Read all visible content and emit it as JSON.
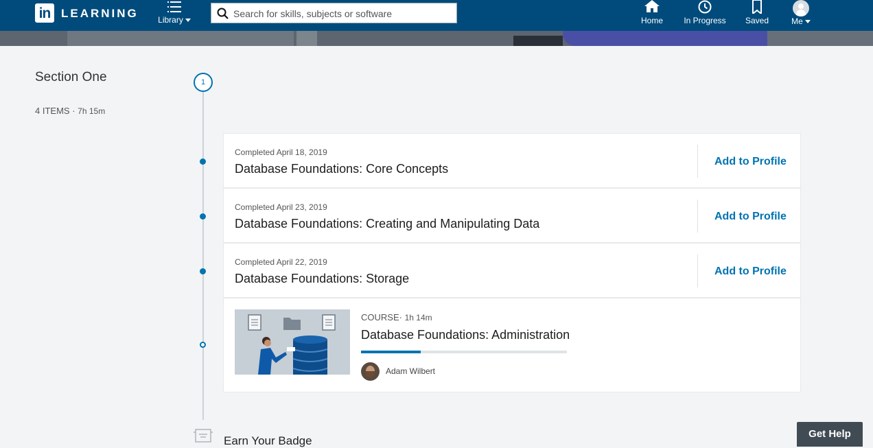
{
  "header": {
    "logo_mark": "in",
    "logo_word": "LEARNING",
    "library_label": "Library",
    "search_placeholder": "Search for skills, subjects or software",
    "nav": {
      "home": "Home",
      "in_progress": "In Progress",
      "saved": "Saved",
      "me": "Me"
    },
    "brand_color": "#004b7c"
  },
  "section": {
    "number": "1",
    "title": "Section One",
    "items_count": "4 ITEMS",
    "separator": "·",
    "duration": "7h 15m"
  },
  "courses": [
    {
      "completed": "Completed April 18, 2019",
      "title": "Database Foundations: Core Concepts",
      "action": "Add to Profile"
    },
    {
      "completed": "Completed April 23, 2019",
      "title": "Database Foundations: Creating and Manipulating Data",
      "action": "Add to Profile"
    },
    {
      "completed": "Completed April 22, 2019",
      "title": "Database Foundations: Storage",
      "action": "Add to Profile"
    }
  ],
  "current_course": {
    "type": "COURSE",
    "separator": "·",
    "duration": "1h 14m",
    "title": "Database Foundations: Administration",
    "progress_fraction": 0.29,
    "author": "Adam Wilbert"
  },
  "badge": {
    "title": "Earn Your Badge"
  },
  "help": {
    "label": "Get Help"
  },
  "accent_color": "#0073b1"
}
